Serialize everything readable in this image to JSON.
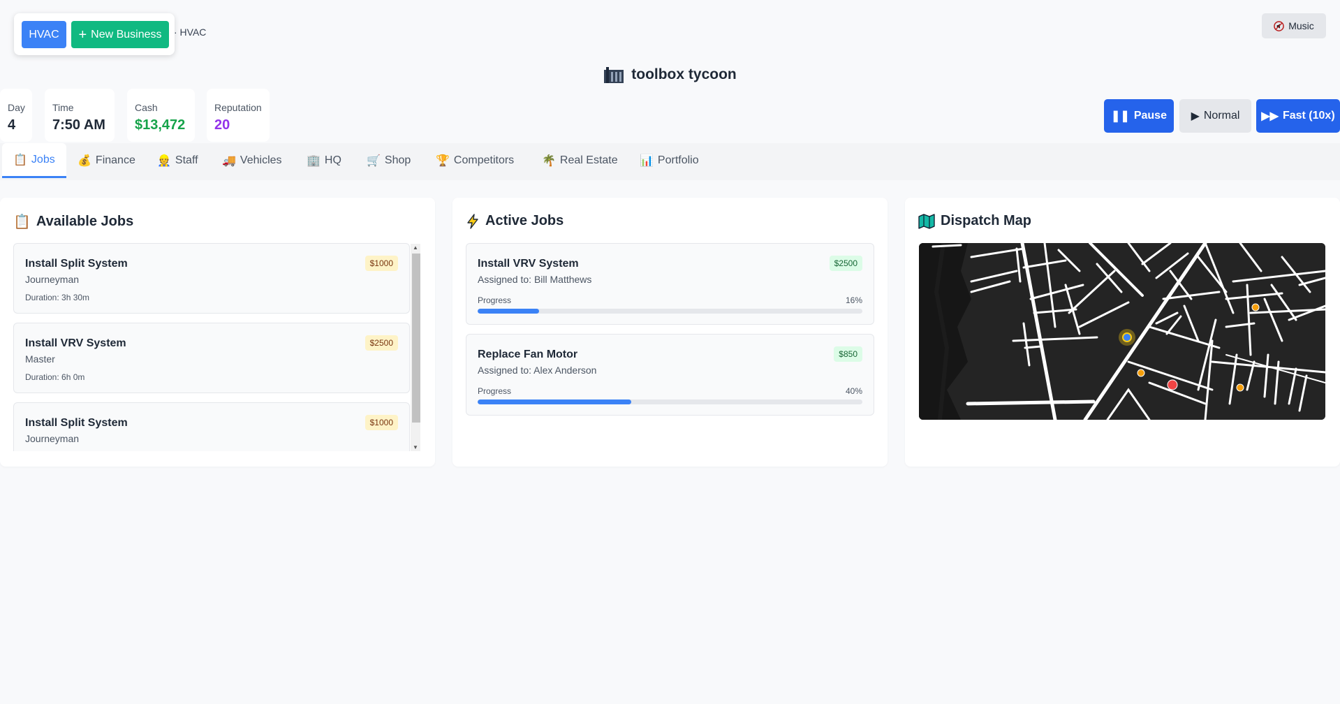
{
  "business": {
    "current_label": "HVAC",
    "new_label": "New Business",
    "breadcrumb": "· HVAC"
  },
  "music_label": "Music",
  "app_title": "toolbox tycoon",
  "stats": [
    {
      "label": "Day",
      "value": "4",
      "color": "#1f2937"
    },
    {
      "label": "Time",
      "value": "7:50 AM",
      "color": "#1f2937"
    },
    {
      "label": "Cash",
      "value": "$13,472",
      "color": "#16a34a"
    },
    {
      "label": "Reputation",
      "value": "20",
      "color": "#9333ea"
    }
  ],
  "speed": {
    "pause": "Pause",
    "normal": "Normal",
    "fast": "Fast (10x)"
  },
  "tabs": [
    {
      "label": "Jobs",
      "icon": "clipboard-icon"
    },
    {
      "label": "Finance",
      "icon": "money-bag-icon"
    },
    {
      "label": "Staff",
      "icon": "worker-icon"
    },
    {
      "label": "Vehicles",
      "icon": "truck-icon"
    },
    {
      "label": "HQ",
      "icon": "building-icon"
    },
    {
      "label": "Shop",
      "icon": "cart-icon"
    },
    {
      "label": "Competitors",
      "icon": "trophy-icon"
    },
    {
      "label": "Real Estate",
      "icon": "palm-tree-icon"
    },
    {
      "label": "Portfolio",
      "icon": "bar-chart-icon"
    }
  ],
  "available": {
    "title": "Available Jobs",
    "jobs": [
      {
        "name": "Install Split System",
        "level": "Journeyman",
        "duration": "Duration: 3h 30m",
        "pay": "$1000"
      },
      {
        "name": "Install VRV System",
        "level": "Master",
        "duration": "Duration: 6h 0m",
        "pay": "$2500"
      },
      {
        "name": "Install Split System",
        "level": "Journeyman",
        "duration": "",
        "pay": "$1000"
      }
    ]
  },
  "active": {
    "title": "Active Jobs",
    "progress_label": "Progress",
    "jobs": [
      {
        "name": "Install VRV System",
        "assigned": "Assigned to: Bill Matthews",
        "pay": "$2500",
        "progress_text": "16%",
        "progress": 0.16
      },
      {
        "name": "Replace Fan Motor",
        "assigned": "Assigned to: Alex Anderson",
        "pay": "$850",
        "progress_text": "40%",
        "progress": 0.4
      }
    ]
  },
  "dispatch": {
    "title": "Dispatch Map"
  },
  "colors": {
    "accent": "#3b82f6",
    "success": "#10b981",
    "map_bg": "#222222"
  }
}
